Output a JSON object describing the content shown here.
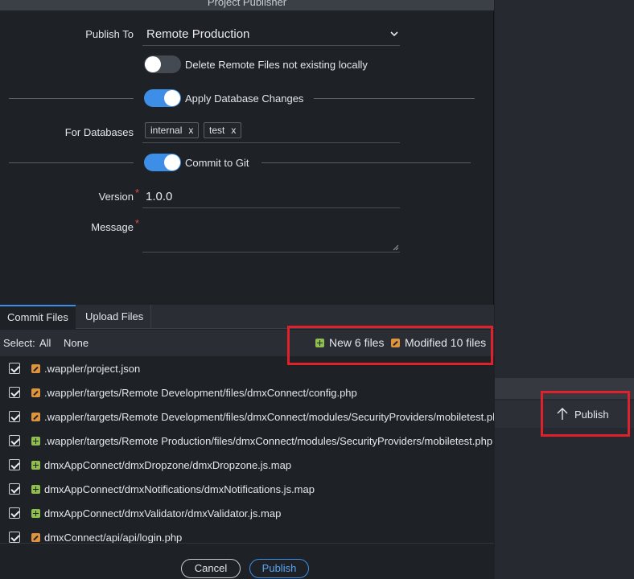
{
  "window": {
    "title": "Project Publisher"
  },
  "form": {
    "publish_to_label": "Publish To",
    "publish_to_value": "Remote Production",
    "delete_remote_label": "Delete Remote Files not existing locally",
    "apply_db_label": "Apply Database Changes",
    "for_databases_label": "For Databases",
    "databases": [
      {
        "name": "internal",
        "remove": "x"
      },
      {
        "name": "test",
        "remove": "x"
      }
    ],
    "commit_git_label": "Commit to Git",
    "version_label": "Version",
    "version_value": "1.0.0",
    "message_label": "Message",
    "required_mark": "*"
  },
  "tabs": [
    {
      "label": "Commit Files",
      "active": true
    },
    {
      "label": "Upload Files",
      "active": false
    }
  ],
  "selection": {
    "select_label": "Select:",
    "all": "All",
    "none": "None",
    "new_summary": "New 6 files",
    "modified_summary": "Modified 10 files"
  },
  "files": [
    {
      "status": "modified",
      "path": ".wappler/project.json"
    },
    {
      "status": "modified",
      "path": ".wappler/targets/Remote Development/files/dmxConnect/config.php"
    },
    {
      "status": "modified",
      "path": ".wappler/targets/Remote Development/files/dmxConnect/modules/SecurityProviders/mobiletest.php"
    },
    {
      "status": "new",
      "path": ".wappler/targets/Remote Production/files/dmxConnect/modules/SecurityProviders/mobiletest.php"
    },
    {
      "status": "new",
      "path": "dmxAppConnect/dmxDropzone/dmxDropzone.js.map"
    },
    {
      "status": "new",
      "path": "dmxAppConnect/dmxNotifications/dmxNotifications.js.map"
    },
    {
      "status": "new",
      "path": "dmxAppConnect/dmxValidator/dmxValidator.js.map"
    },
    {
      "status": "modified",
      "path": "dmxConnect/api/api/login.php"
    }
  ],
  "footer": {
    "cancel": "Cancel",
    "publish": "Publish"
  },
  "side_panel": {
    "publish": "Publish"
  },
  "colors": {
    "accent": "#3d8ee6",
    "new": "#8fbf4a",
    "modified": "#e0933a",
    "highlight": "#e0202a"
  }
}
